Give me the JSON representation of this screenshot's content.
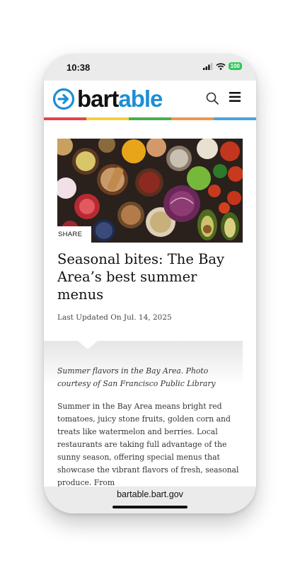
{
  "status_bar": {
    "time": "10:38",
    "battery": "100"
  },
  "header": {
    "logo_prefix": "bart",
    "logo_suffix": "able"
  },
  "brand_colors": {
    "logo_blue": "#1c8fd6",
    "stripe": [
      "#e0464a",
      "#f2cf3c",
      "#4aae4f",
      "#f0964a",
      "#4aa3df"
    ]
  },
  "article": {
    "share_label": "SHARE",
    "title": "Seasonal bites: The Bay Area’s best summer menus",
    "updated": "Last Updated On Jul. 14, 2025",
    "caption": "Summer flavors in the Bay Area. Photo courtesy of San Francisco Public Library",
    "body": "Summer in the Bay Area means bright red tomatoes, juicy stone fruits, golden corn and treats like watermelon and berries. Local restaurants are taking full advantage of the sunny season, offering special menus that showcase the vibrant flavors of fresh, seasonal produce. From"
  },
  "browser": {
    "url": "bartable.bart.gov"
  },
  "icons": {
    "search": "search-icon",
    "menu": "menu-icon"
  }
}
